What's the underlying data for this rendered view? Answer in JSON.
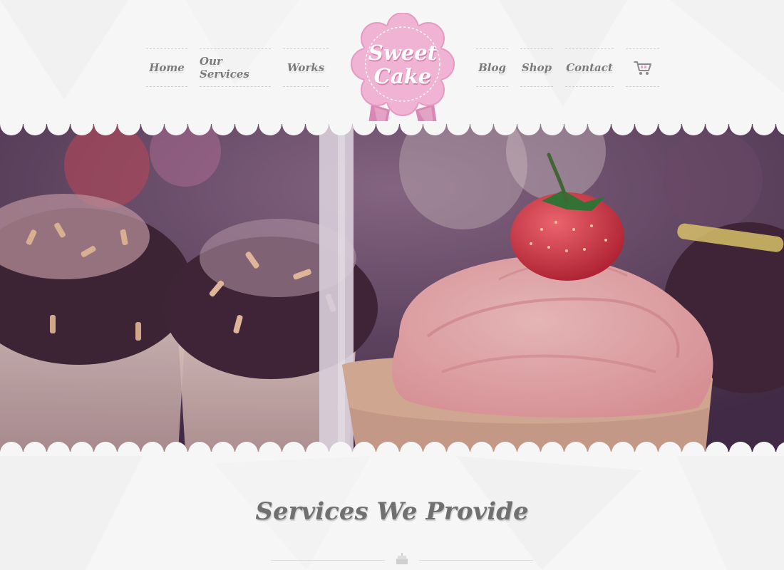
{
  "nav": {
    "left": [
      {
        "label": "Home"
      },
      {
        "label": "Our Services"
      },
      {
        "label": "Works"
      }
    ],
    "right": [
      {
        "label": "Blog"
      },
      {
        "label": "Shop"
      },
      {
        "label": "Contact"
      }
    ],
    "cart_icon": "shopping-cart-icon"
  },
  "logo": {
    "line1": "Sweet",
    "line2": "Cake",
    "colors": {
      "badge": "#f0b3d3",
      "border": "#e59ac1",
      "ribbon": "#d987b4"
    }
  },
  "hero": {
    "image": "cupcakes-photo",
    "tint": "#5a3a5e"
  },
  "services": {
    "title": "Services We Provide",
    "divider_icon": "cake-icon"
  },
  "colors": {
    "background": "#f7f6f6",
    "nav_text": "#7a7a7a",
    "heading": "#707070"
  }
}
